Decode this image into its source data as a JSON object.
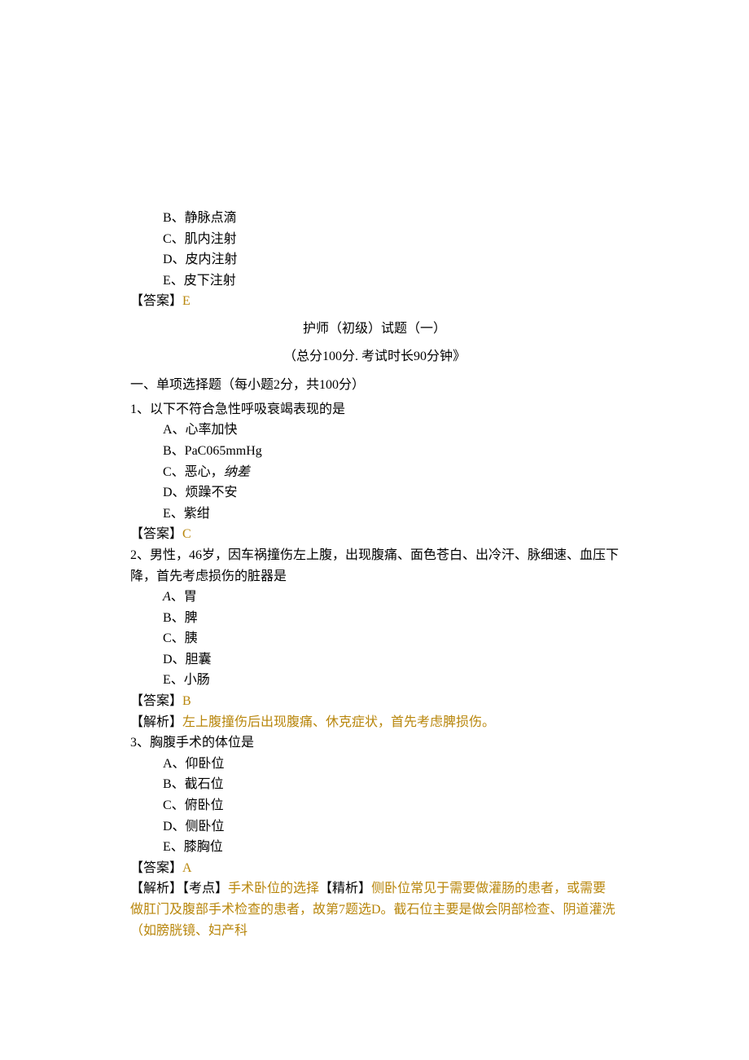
{
  "pre_options": {
    "b": "B、静脉点滴",
    "c": "C、肌内注射",
    "d": "D、皮内注射",
    "e": "E、皮下注射"
  },
  "pre_answer_label": "【答案】",
  "pre_answer_value": "E",
  "title": "护师（初级）试题（一）",
  "subtitle": "（总分100分. 考试时长90分钟》",
  "section_header": "一、单项选择题（每小题2分，共100分）",
  "answer_label": "【答案】",
  "analysis_label": "【解析】",
  "q1": {
    "stem": "1、以下不符合急性呼吸衰竭表现的是",
    "a": "A、心率加快",
    "b": "B、PaC065mmHg",
    "c_prefix": "C、恶心，",
    "c_italic": "纳差",
    "d": "D、烦躁不安",
    "e": "E、紫绀",
    "answer": "C"
  },
  "q2": {
    "stem": "2、男性，46岁，因车祸撞伤左上腹，出现腹痛、面色苍白、出冷汗、脉细速、血压下降，首先考虑损伤的脏器是",
    "a_prefix": "A",
    "a_suffix": "、胃",
    "b": "B、脾",
    "c": "C、胰",
    "d": "D、胆囊",
    "e": "E、小肠",
    "answer": "B",
    "analysis": "左上腹撞伤后出现腹痛、休克症状，首先考虑脾损伤。"
  },
  "q3": {
    "stem": "3、胸腹手术的体位是",
    "a": "A、仰卧位",
    "b": "B、截石位",
    "c": "C、俯卧位",
    "d": "D、侧卧位",
    "e": "E、膝胸位",
    "answer": "A",
    "analysis_prefix": "【考点】",
    "analysis_part1": "手术卧位的选择",
    "analysis_mid": "【精析】",
    "analysis_part2": "侧卧位常见于需要做灌肠的患者，或需要做肛门及腹部手术检查的患者，故第7题选D。截石位主要是做会阴部检查、阴道灌洗（如膀胱镜、妇产科"
  }
}
